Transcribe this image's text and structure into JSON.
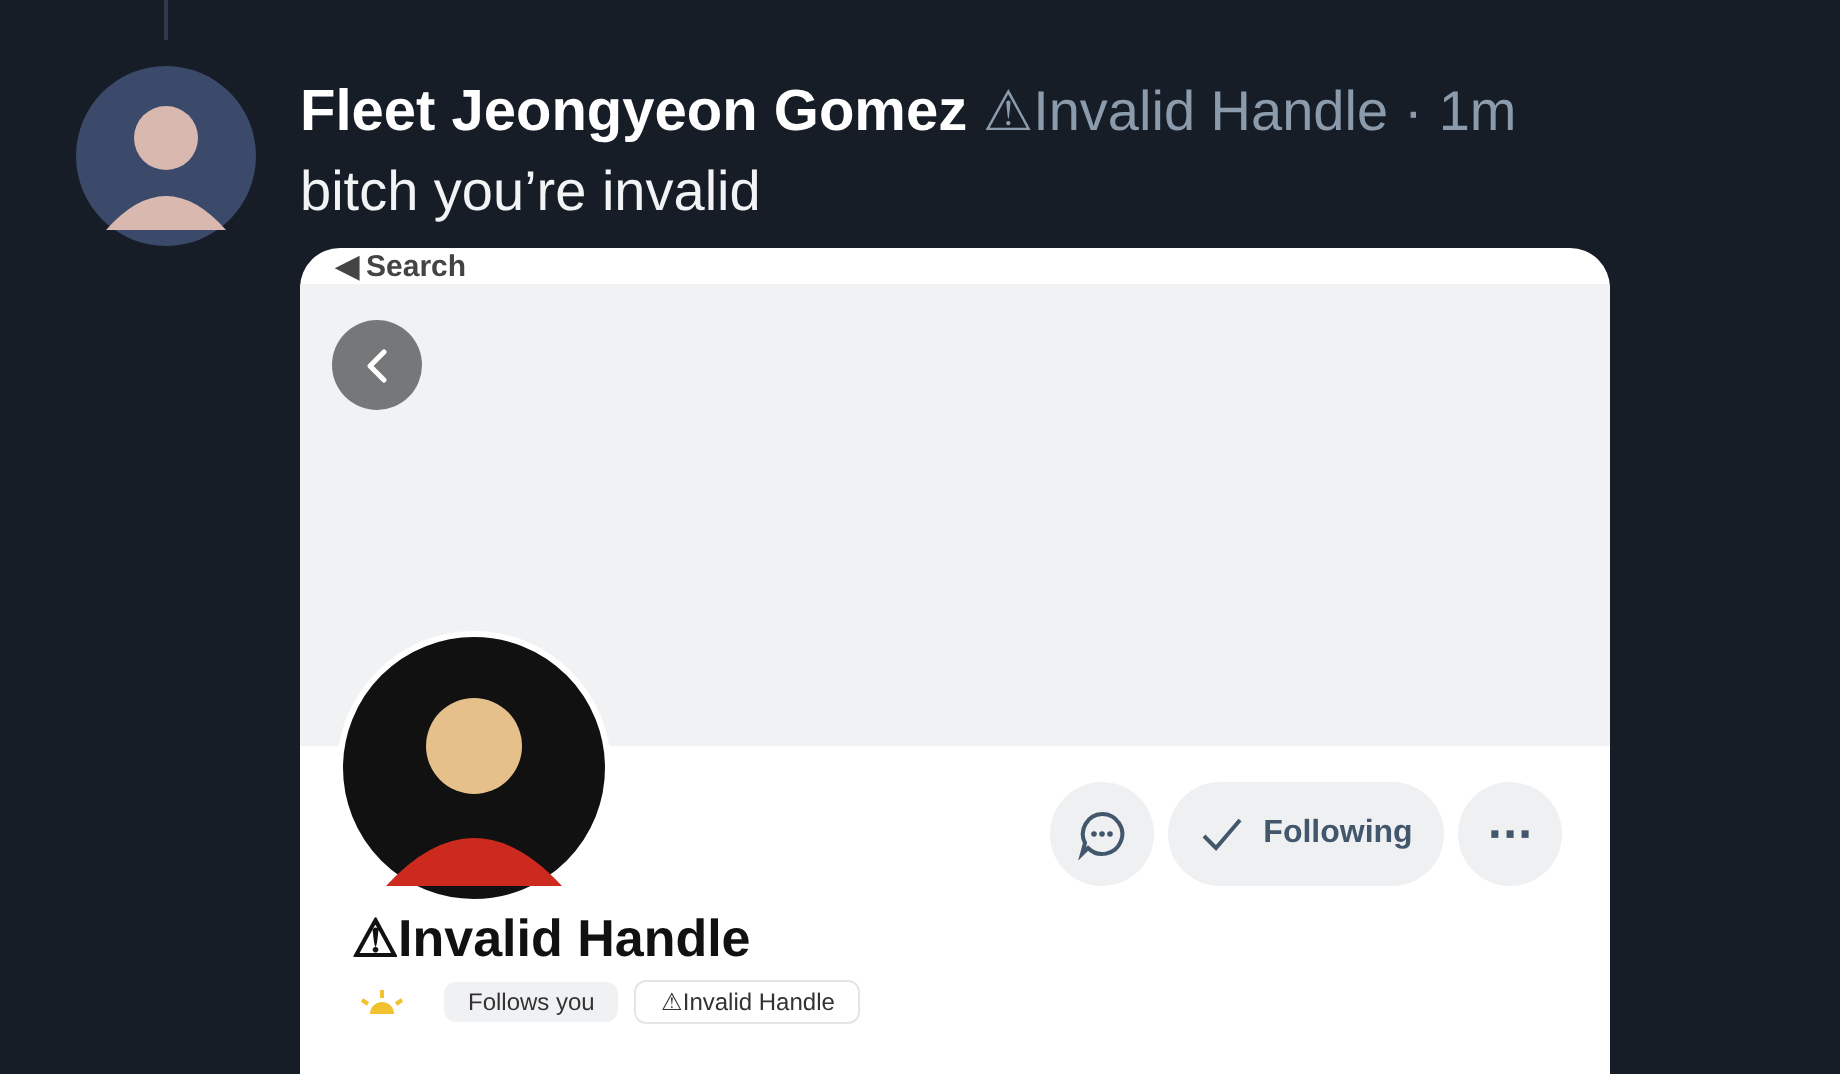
{
  "post": {
    "author": "Fleet Jeongyeon Gomez",
    "handle": "⚠Invalid Handle",
    "separator": "·",
    "time": "1m",
    "text": "bitch you’re invalid"
  },
  "embed": {
    "status_back": "◀",
    "status_label": "Search",
    "profile": {
      "name": "⚠Invalid Handle",
      "follow_button": "Following",
      "more": "···",
      "chips": [
        "Follows you",
        "⚠Invalid Handle"
      ]
    }
  }
}
